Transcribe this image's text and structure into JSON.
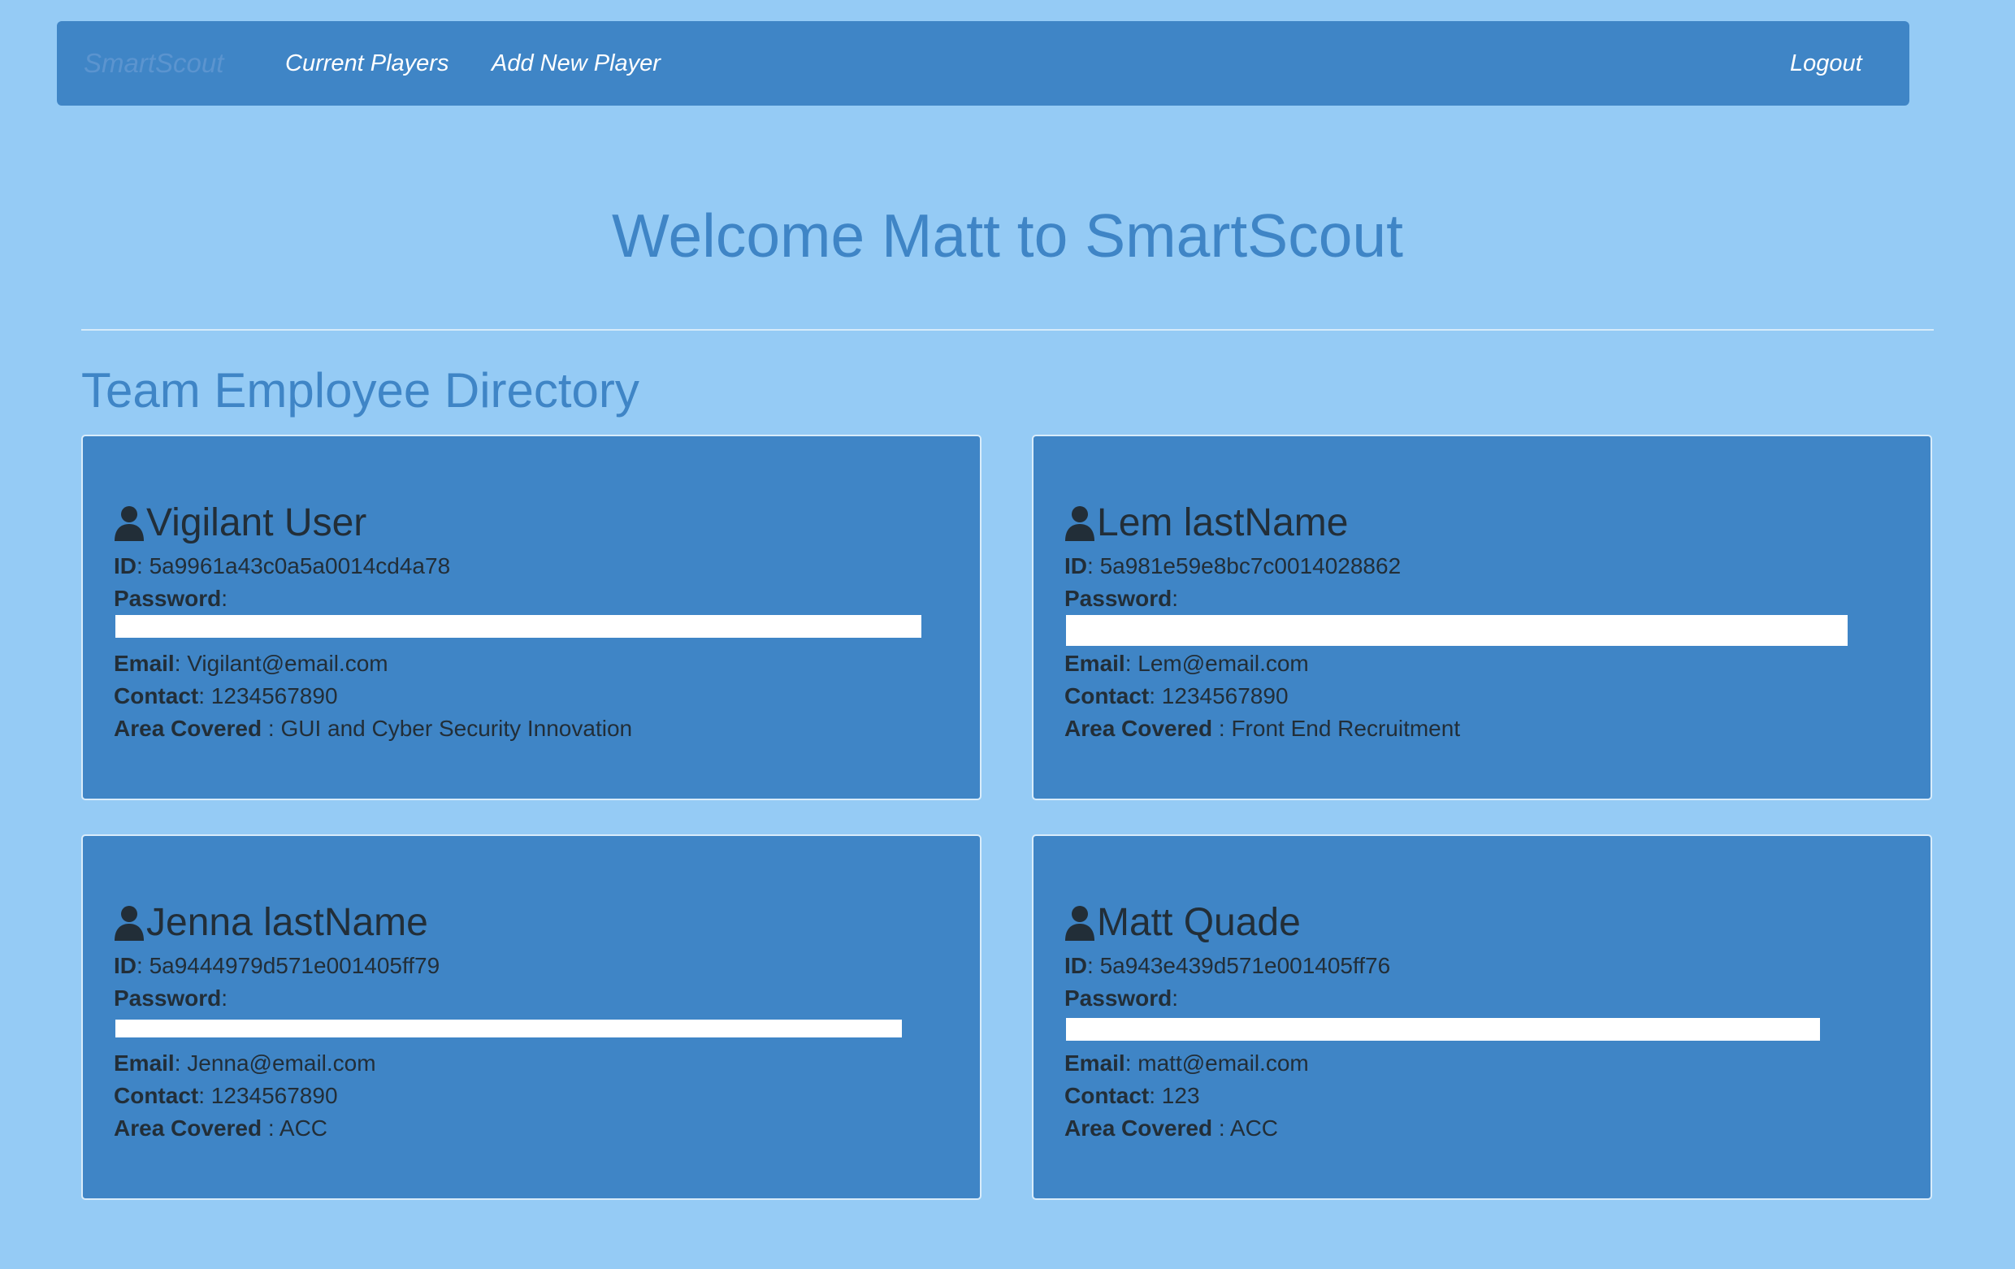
{
  "nav": {
    "brand": "SmartScout",
    "current_players": "Current Players",
    "add_new_player": "Add New Player",
    "logout": "Logout"
  },
  "welcome": "Welcome Matt to SmartScout",
  "section_title": "Team Employee Directory",
  "labels": {
    "id": "ID",
    "password": "Password",
    "email": "Email",
    "contact": "Contact",
    "area": "Area Covered"
  },
  "employees": [
    {
      "name": "Vigilant User",
      "id": "5a9961a43c0a5a0014cd4a78",
      "email": "Vigilant@email.com",
      "contact": "1234567890",
      "area": "GUI and Cyber Security Innovation"
    },
    {
      "name": "Lem lastName",
      "id": "5a981e59e8bc7c0014028862",
      "email": "Lem@email.com",
      "contact": "1234567890",
      "area": "Front End Recruitment"
    },
    {
      "name": "Jenna lastName",
      "id": "5a9444979d571e001405ff79",
      "email": "Jenna@email.com",
      "contact": "1234567890",
      "area": "ACC"
    },
    {
      "name": "Matt Quade",
      "id": "5a943e439d571e001405ff76",
      "email": "matt@email.com",
      "contact": "123",
      "area": "ACC"
    }
  ],
  "colors": {
    "page_background": "#95CBF5",
    "navbar": "#3F85C6",
    "card": "#3F85C6",
    "heading_text": "#3F85C6",
    "card_text": "#222E38"
  },
  "icons": {
    "user": "user-icon"
  }
}
